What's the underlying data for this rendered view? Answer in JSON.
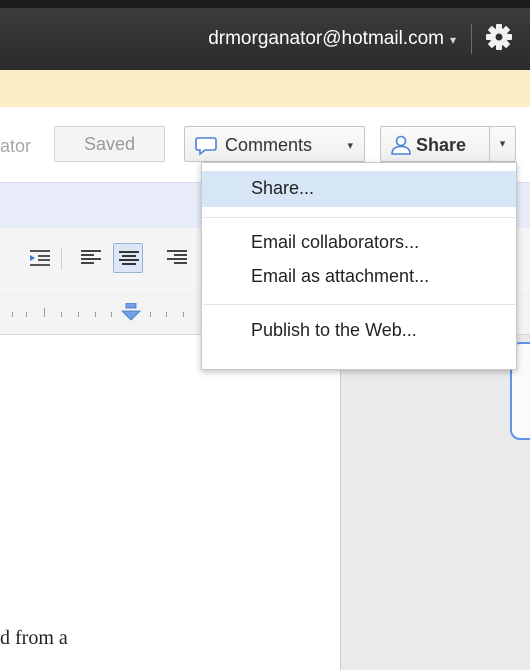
{
  "topbar": {
    "account_email": "drmorganator@hotmail.com",
    "account_caret": "▾",
    "settings_icon": "gear-icon"
  },
  "toolbar": {
    "collaborator_text": "ator",
    "saved_label": "Saved",
    "comments_label": "Comments",
    "comments_caret": "▾",
    "share_label": "Share",
    "share_caret": "▾"
  },
  "share_menu": {
    "items": [
      {
        "label": "Share..."
      },
      {
        "label": "Email collaborators..."
      },
      {
        "label": "Email as attachment..."
      },
      {
        "label": "Publish to the Web..."
      }
    ]
  },
  "document": {
    "visible_text": "d from a"
  },
  "colors": {
    "topbar": "#2f2f2f",
    "notice": "#fbeec4",
    "menu_highlight": "#d6e6f7",
    "accent_blue": "#5e93e6"
  }
}
